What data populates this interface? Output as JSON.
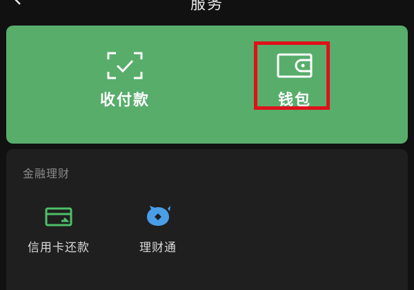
{
  "header": {
    "title": "服务",
    "back_icon": "chevron-left-icon",
    "more_icon": "more-dots-icon"
  },
  "wechat_pay": {
    "background": "#58ad6b",
    "entries": [
      {
        "label": "收付款",
        "icon": "scan-check-icon"
      },
      {
        "label": "钱包",
        "icon": "wallet-icon",
        "highlighted": true
      }
    ],
    "highlight_color": "#e0101a"
  },
  "finance": {
    "section_title": "金融理财",
    "items": [
      {
        "label": "信用卡还款",
        "icon": "credit-card-repay-icon",
        "color": "#4fbf6a"
      },
      {
        "label": "理财通",
        "icon": "licaitong-icon",
        "color": "#4a9ee8"
      }
    ]
  }
}
